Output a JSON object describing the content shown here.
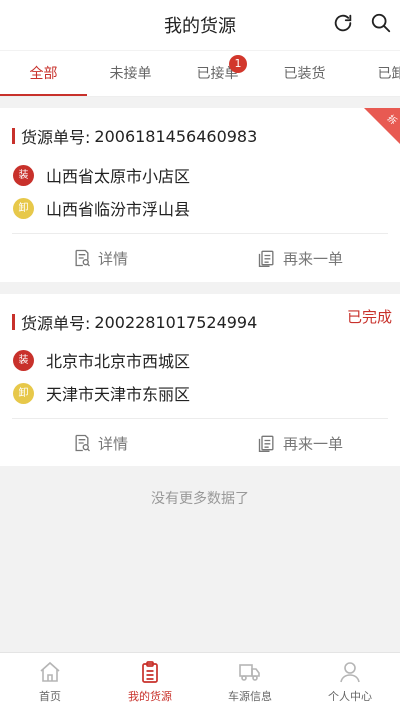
{
  "header": {
    "title": "我的货源",
    "refresh_icon": "refresh-icon",
    "search_icon": "search-icon"
  },
  "tabs": [
    {
      "label": "全部",
      "active": true
    },
    {
      "label": "未接单"
    },
    {
      "label": "已接单",
      "badge": "1"
    },
    {
      "label": "已装货"
    },
    {
      "label": "已卸"
    }
  ],
  "orders": [
    {
      "label": "货源单号:",
      "number": "2006181456460983",
      "corner_tag": "拆",
      "status": "",
      "load_badge": "装",
      "load_address": "山西省太原市小店区",
      "unload_badge": "卸",
      "unload_address": "山西省临汾市浮山县",
      "detail_label": "详情",
      "reorder_label": "再来一单"
    },
    {
      "label": "货源单号:",
      "number": "2002281017524994",
      "status": "已完成",
      "load_badge": "装",
      "load_address": "北京市北京市西城区",
      "unload_badge": "卸",
      "unload_address": "天津市天津市东丽区",
      "detail_label": "详情",
      "reorder_label": "再来一单"
    }
  ],
  "no_more_text": "没有更多数据了",
  "bottom_nav": [
    {
      "label": "首页",
      "icon": "home-icon"
    },
    {
      "label": "我的货源",
      "icon": "clipboard-icon",
      "active": true
    },
    {
      "label": "车源信息",
      "icon": "truck-icon"
    },
    {
      "label": "个人中心",
      "icon": "user-icon"
    }
  ],
  "colors": {
    "accent": "#c8312b",
    "unload": "#e7c84a",
    "background": "#f2f2f2"
  }
}
